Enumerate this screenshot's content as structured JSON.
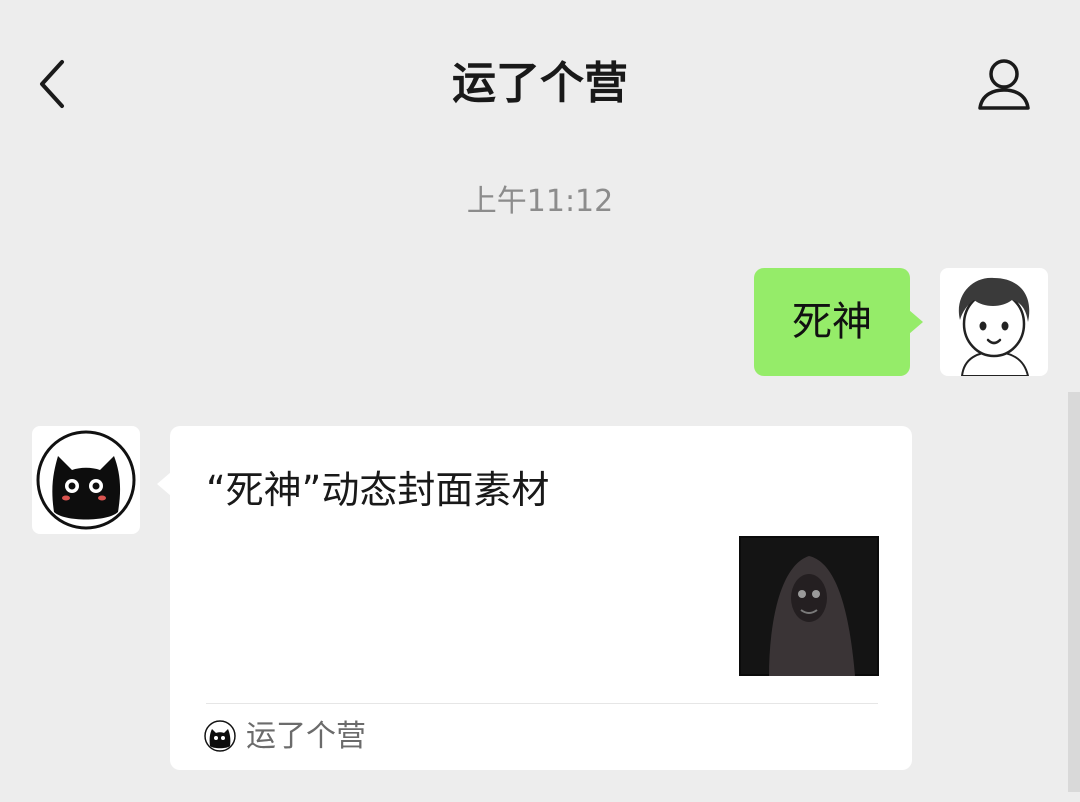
{
  "header": {
    "title": "运了个营",
    "back_icon": "chevron-left-icon",
    "profile_icon": "person-outline-icon"
  },
  "chat": {
    "timestamp": "上午11:12",
    "sent_message": {
      "text": "死神",
      "bubble_color": "#95ec69"
    },
    "received_card": {
      "title": "“死神”动态封面素材",
      "source_name": "运了个营",
      "source_icon": "black-cat-icon"
    }
  },
  "colors": {
    "background": "#ededed",
    "bubble_green": "#95ec69",
    "card_bg": "#ffffff"
  }
}
